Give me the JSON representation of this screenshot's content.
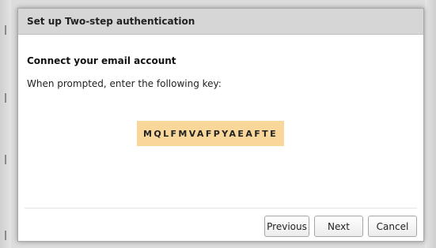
{
  "dialog": {
    "title": "Set up Two-step authentication",
    "section_title": "Connect your email account",
    "instruction": "When prompted, enter the following key:",
    "key": "MQLFMVAFPYAEAFTE",
    "buttons": {
      "previous": "Previous",
      "next": "Next",
      "cancel": "Cancel"
    }
  },
  "colors": {
    "header_bg": "#d6d6d6",
    "key_highlight": "#f9d79a",
    "backdrop": "#dcdcdc"
  }
}
